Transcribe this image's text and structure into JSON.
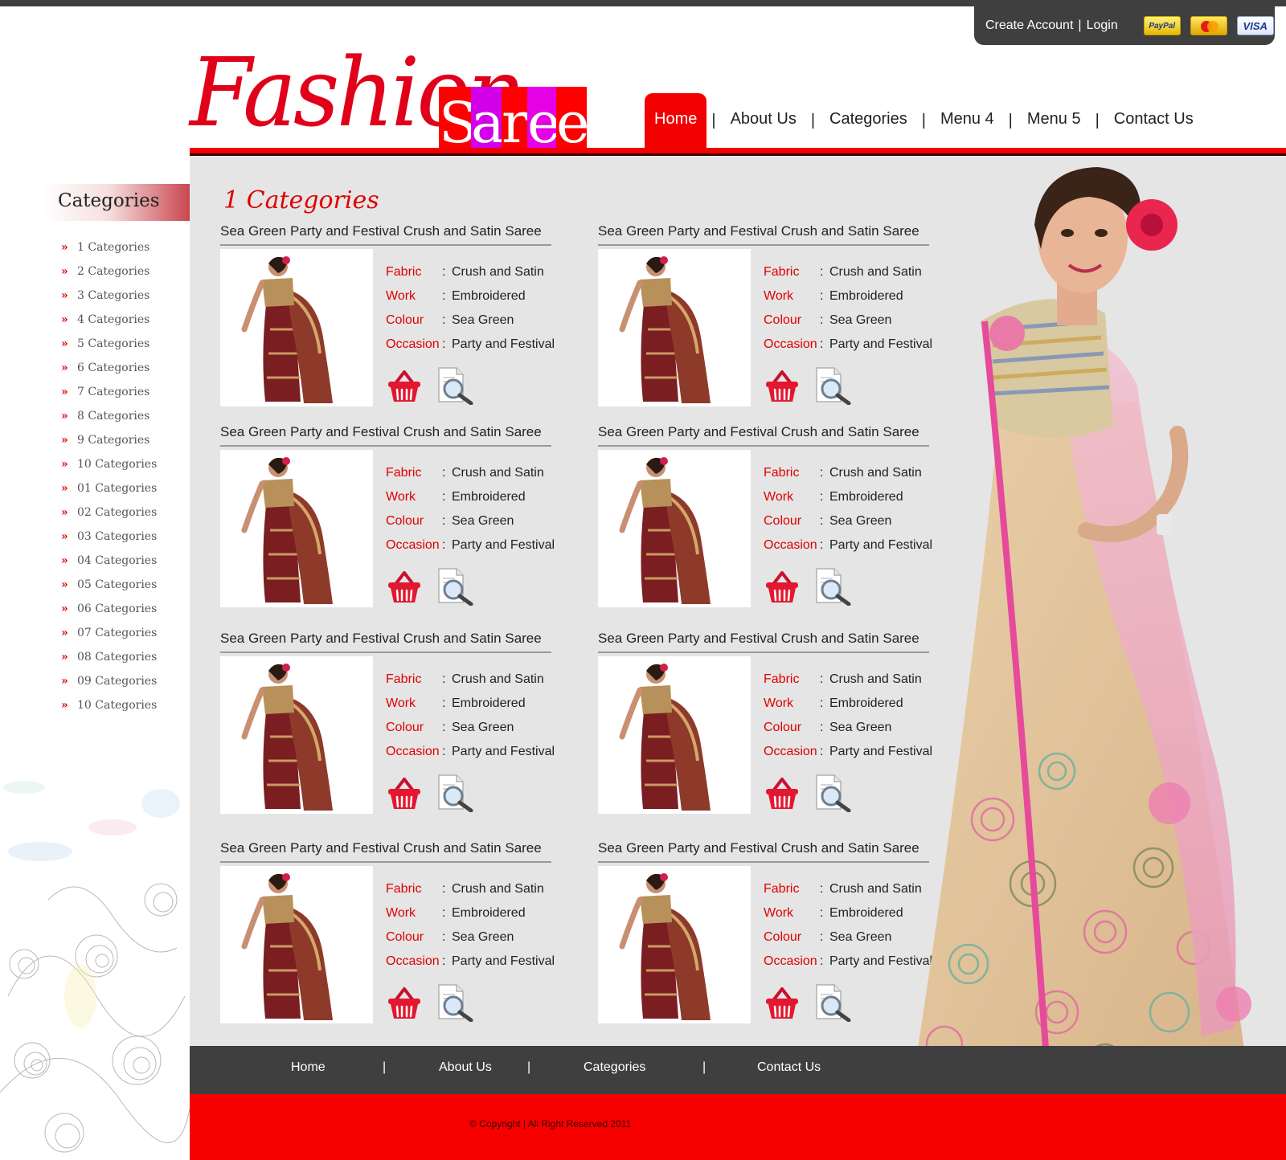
{
  "account": {
    "create": "Create Account",
    "separator": "|",
    "login": "Login"
  },
  "payments": {
    "paypal": "PayPal",
    "visa": "VISA"
  },
  "logo": {
    "word1": "Fashion",
    "word2_letters": [
      "S",
      "a",
      "r",
      "e",
      "e"
    ],
    "letter_colors": [
      "#ff0000",
      "#d100e8",
      "#ff0000",
      "#e600e6",
      "#ff0000"
    ],
    "brand_red": "#e0001a"
  },
  "nav": {
    "items": [
      "Home",
      "About Us",
      "Categories",
      "Menu 4",
      "Menu 5",
      "Contact Us"
    ],
    "separator": "|",
    "active": "Home"
  },
  "sidebar": {
    "title": "Categories",
    "bullet": "»",
    "items": [
      "1 Categories",
      "2 Categories",
      "3 Categories",
      "4 Categories",
      "5 Categories",
      "6 Categories",
      "7 Categories",
      "8 Categories",
      "9 Categories",
      "10 Categories",
      "01 Categories",
      "02 Categories",
      "03 Categories",
      "04 Categories",
      "05 Categories",
      "06 Categories",
      "07 Categories",
      "08 Categories",
      "09 Categories",
      "10 Categories"
    ]
  },
  "main": {
    "title": "1 Categories",
    "products": [
      {
        "title": "Sea Green Party and Festival Crush and Satin Saree",
        "fabric_label": "Fabric",
        "fabric": "Crush and Satin",
        "work_label": "Work",
        "work": "Embroidered",
        "colour_label": "Colour",
        "colour": "Sea Green",
        "occasion_label": "Occasion",
        "occasion": "Party and Festival"
      },
      {
        "title": "Sea Green Party and Festival Crush and Satin Saree",
        "fabric_label": "Fabric",
        "fabric": "Crush and Satin",
        "work_label": "Work",
        "work": "Embroidered",
        "colour_label": "Colour",
        "colour": "Sea Green",
        "occasion_label": "Occasion",
        "occasion": "Party and Festival"
      },
      {
        "title": "Sea Green Party and Festival Crush and Satin Saree",
        "fabric_label": "Fabric",
        "fabric": "Crush and Satin",
        "work_label": "Work",
        "work": "Embroidered",
        "colour_label": "Colour",
        "colour": "Sea Green",
        "occasion_label": "Occasion",
        "occasion": "Party and Festival"
      },
      {
        "title": "Sea Green Party and Festival Crush and Satin Saree",
        "fabric_label": "Fabric",
        "fabric": "Crush and Satin",
        "work_label": "Work",
        "work": "Embroidered",
        "colour_label": "Colour",
        "colour": "Sea Green",
        "occasion_label": "Occasion",
        "occasion": "Party and Festival"
      },
      {
        "title": "Sea Green Party and Festival Crush and Satin Saree",
        "fabric_label": "Fabric",
        "fabric": "Crush and Satin",
        "work_label": "Work",
        "work": "Embroidered",
        "colour_label": "Colour",
        "colour": "Sea Green",
        "occasion_label": "Occasion",
        "occasion": "Party and Festival"
      },
      {
        "title": "Sea Green Party and Festival Crush and Satin Saree",
        "fabric_label": "Fabric",
        "fabric": "Crush and Satin",
        "work_label": "Work",
        "work": "Embroidered",
        "colour_label": "Colour",
        "colour": "Sea Green",
        "occasion_label": "Occasion",
        "occasion": "Party and Festival"
      },
      {
        "title": "Sea Green Party and Festival Crush and Satin Saree",
        "fabric_label": "Fabric",
        "fabric": "Crush and Satin",
        "work_label": "Work",
        "work": "Embroidered",
        "colour_label": "Colour",
        "colour": "Sea Green",
        "occasion_label": "Occasion",
        "occasion": "Party and Festival"
      },
      {
        "title": "Sea Green Party and Festival Crush and Satin Saree",
        "fabric_label": "Fabric",
        "fabric": "Crush and Satin",
        "work_label": "Work",
        "work": "Embroidered",
        "colour_label": "Colour",
        "colour": "Sea Green",
        "occasion_label": "Occasion",
        "occasion": "Party and Festival"
      }
    ],
    "icons": {
      "cart": "shopping-basket-icon",
      "zoom": "magnifier-icon"
    }
  },
  "footer": {
    "items": [
      "Home",
      "About Us",
      "Categories",
      "Contact Us"
    ],
    "separator": "|",
    "copyright": "© Copyright | All Right Reserved 2011"
  },
  "colors": {
    "accent_red": "#f20000",
    "dark_gray": "#3f3f3f",
    "panel_gray": "#e5e5e5"
  }
}
